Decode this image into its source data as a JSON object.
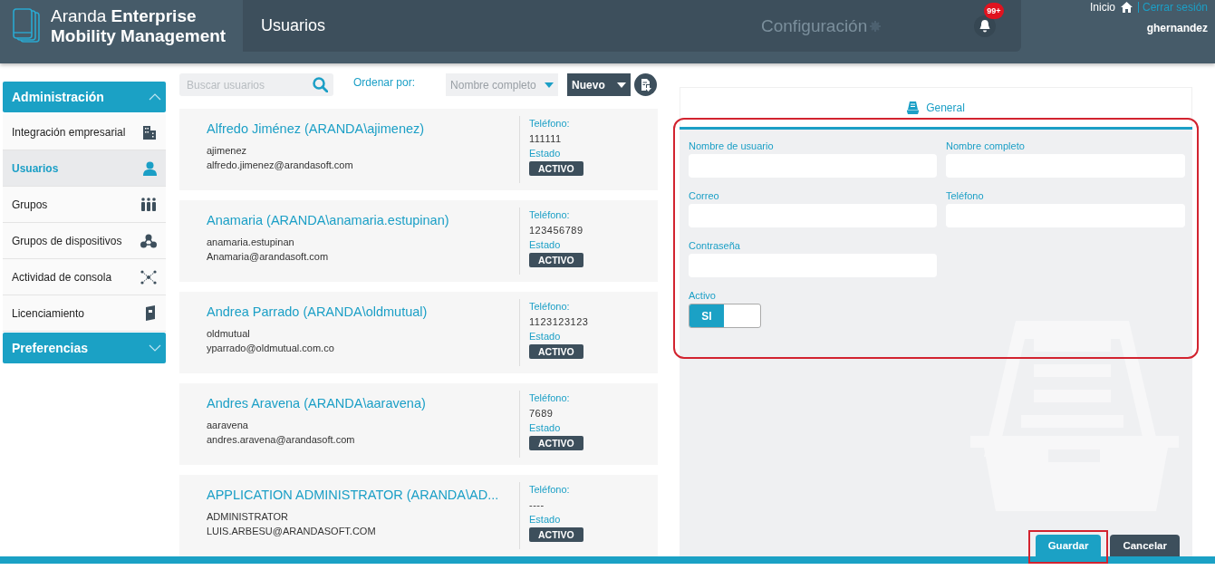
{
  "header": {
    "logo_line1": "Aranda **Enterprise**",
    "logo_line2": "Mobility Management",
    "page_title": "Usuarios",
    "config_label": "Configuración",
    "notification_count": "99+",
    "home_link": "Inicio",
    "logout_link": "Cerrar sesión",
    "username": "ghernandez"
  },
  "sidebar": {
    "sections": [
      {
        "title": "Administración",
        "expanded": true,
        "items": [
          {
            "label": "Integración empresarial",
            "selected": false
          },
          {
            "label": "Usuarios",
            "selected": true
          },
          {
            "label": "Grupos",
            "selected": false
          },
          {
            "label": "Grupos de dispositivos",
            "selected": false
          },
          {
            "label": "Actividad de consola",
            "selected": false
          },
          {
            "label": "Licenciamiento",
            "selected": false
          }
        ]
      },
      {
        "title": "Preferencias",
        "expanded": false
      }
    ]
  },
  "toolbar": {
    "search": {
      "placeholder": "Buscar usuarios"
    },
    "sort_label": "Ordenar por:",
    "sort_value": "Nombre completo",
    "new_button": "Nuevo"
  },
  "users": [
    {
      "name": "Alfredo Jiménez (ARANDA\\ajimenez)",
      "username": "ajimenez",
      "email": "alfredo.jimenez@arandasoft.com",
      "phone_label": "Teléfono:",
      "phone": "111111",
      "status_label": "Estado",
      "status": "ACTIVO"
    },
    {
      "name": "Anamaria (ARANDA\\anamaria.estupinan)",
      "username": "anamaria.estupinan",
      "email": "Anamaria@arandasoft.com",
      "phone_label": "Teléfono:",
      "phone": "123456789",
      "status_label": "Estado",
      "status": "ACTIVO"
    },
    {
      "name": "Andrea Parrado (ARANDA\\oldmutual)",
      "username": "oldmutual",
      "email": "yparrado@oldmutual.com.co",
      "phone_label": "Teléfono:",
      "phone": "1123123123",
      "status_label": "Estado",
      "status": "ACTIVO"
    },
    {
      "name": "Andres Aravena (ARANDA\\aaravena)",
      "username": "aaravena",
      "email": "andres.aravena@arandasoft.com",
      "phone_label": "Teléfono:",
      "phone": "7689",
      "status_label": "Estado",
      "status": "ACTIVO"
    },
    {
      "name": "APPLICATION ADMINISTRATOR (ARANDA\\AD...",
      "username": "ADMINISTRATOR",
      "email": "LUIS.ARBESU@ARANDASOFT.COM",
      "phone_label": "Teléfono:",
      "phone": "----",
      "status_label": "Estado",
      "status": "ACTIVO"
    }
  ],
  "form": {
    "tabs": [
      {
        "label": "General",
        "selected": true
      }
    ],
    "fields": [
      {
        "label": "Nombre de usuario"
      },
      {
        "label": "Nombre completo"
      },
      {
        "label": "Correo"
      },
      {
        "label": "Teléfono"
      },
      {
        "label": "Contraseña"
      }
    ],
    "toggle": {
      "label": "Activo",
      "on": true,
      "on_text": "SI"
    },
    "buttons": [
      {
        "label": "Guardar",
        "kind": "primary"
      },
      {
        "label": "Cancelar",
        "kind": "secondary"
      }
    ]
  }
}
